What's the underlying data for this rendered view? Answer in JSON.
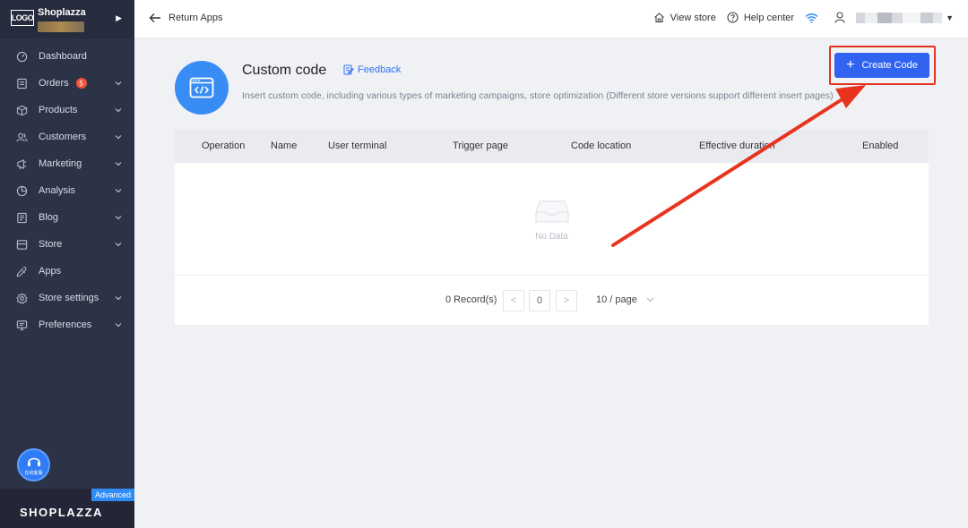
{
  "sidebar": {
    "logo_text": "LOGO",
    "brand_name": "Shoplazza",
    "items": [
      {
        "label": "Dashboard",
        "icon": "dashboard-icon",
        "has_chevron": false
      },
      {
        "label": "Orders",
        "icon": "orders-icon",
        "has_chevron": true,
        "badge": "5"
      },
      {
        "label": "Products",
        "icon": "products-icon",
        "has_chevron": true
      },
      {
        "label": "Customers",
        "icon": "customers-icon",
        "has_chevron": true
      },
      {
        "label": "Marketing",
        "icon": "marketing-icon",
        "has_chevron": true
      },
      {
        "label": "Analysis",
        "icon": "analysis-icon",
        "has_chevron": true
      },
      {
        "label": "Blog",
        "icon": "blog-icon",
        "has_chevron": true
      },
      {
        "label": "Store",
        "icon": "store-icon",
        "has_chevron": true
      },
      {
        "label": "Apps",
        "icon": "apps-icon",
        "has_chevron": false
      },
      {
        "label": "Store settings",
        "icon": "store-settings-icon",
        "has_chevron": true
      },
      {
        "label": "Preferences",
        "icon": "preferences-icon",
        "has_chevron": true
      }
    ],
    "support_label": "在线客服",
    "plan_badge": "Advanced",
    "footer_logo": "SHOPLAZZA"
  },
  "topbar": {
    "back_label": "Return Apps",
    "view_store": "View store",
    "help_center": "Help center"
  },
  "page": {
    "title": "Custom code",
    "feedback": "Feedback",
    "description": "Insert custom code, including various types of marketing campaigns, store optimization (Different store versions support different insert pages)",
    "create_button": "Create Code"
  },
  "table": {
    "columns": [
      "Operation",
      "Name",
      "User terminal",
      "Trigger page",
      "Code location",
      "Effective duration",
      "Enabled"
    ],
    "empty_text": "No Data"
  },
  "pagination": {
    "records": "0 Record(s)",
    "prev": "<",
    "current_page": "0",
    "next": ">",
    "per_page": "10 / page"
  },
  "colors": {
    "sidebar_bg": "#2d3347",
    "primary": "#2f63f0",
    "highlight": "#e53321",
    "badge": "#f0543a"
  }
}
